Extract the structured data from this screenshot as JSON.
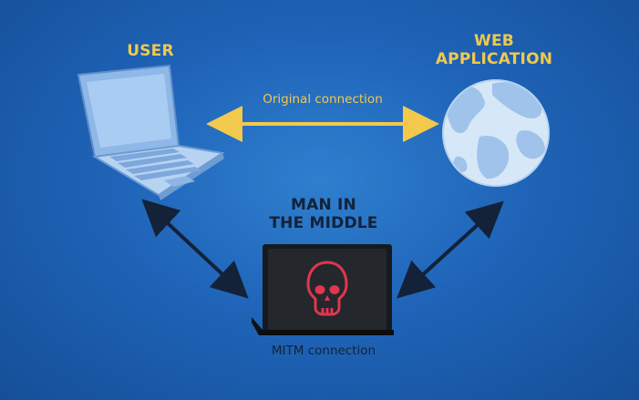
{
  "diagram": {
    "user_title": "USER",
    "web_title_line1": "WEB",
    "web_title_line2": "APPLICATION",
    "mitm_title_line1": "MAN IN",
    "mitm_title_line2": "THE MIDDLE",
    "original_connection_label": "Original connection",
    "mitm_connection_label": "MITM connection"
  },
  "colors": {
    "background": "#1f64b8",
    "title_yellow": "#f2c94c",
    "arrow_dark": "#132238",
    "skull_red": "#e0364f"
  },
  "icons": {
    "user_node": "laptop-icon",
    "web_node": "globe-icon",
    "mitm_node": "hacker-laptop-icon",
    "mitm_symbol": "skull-icon"
  }
}
